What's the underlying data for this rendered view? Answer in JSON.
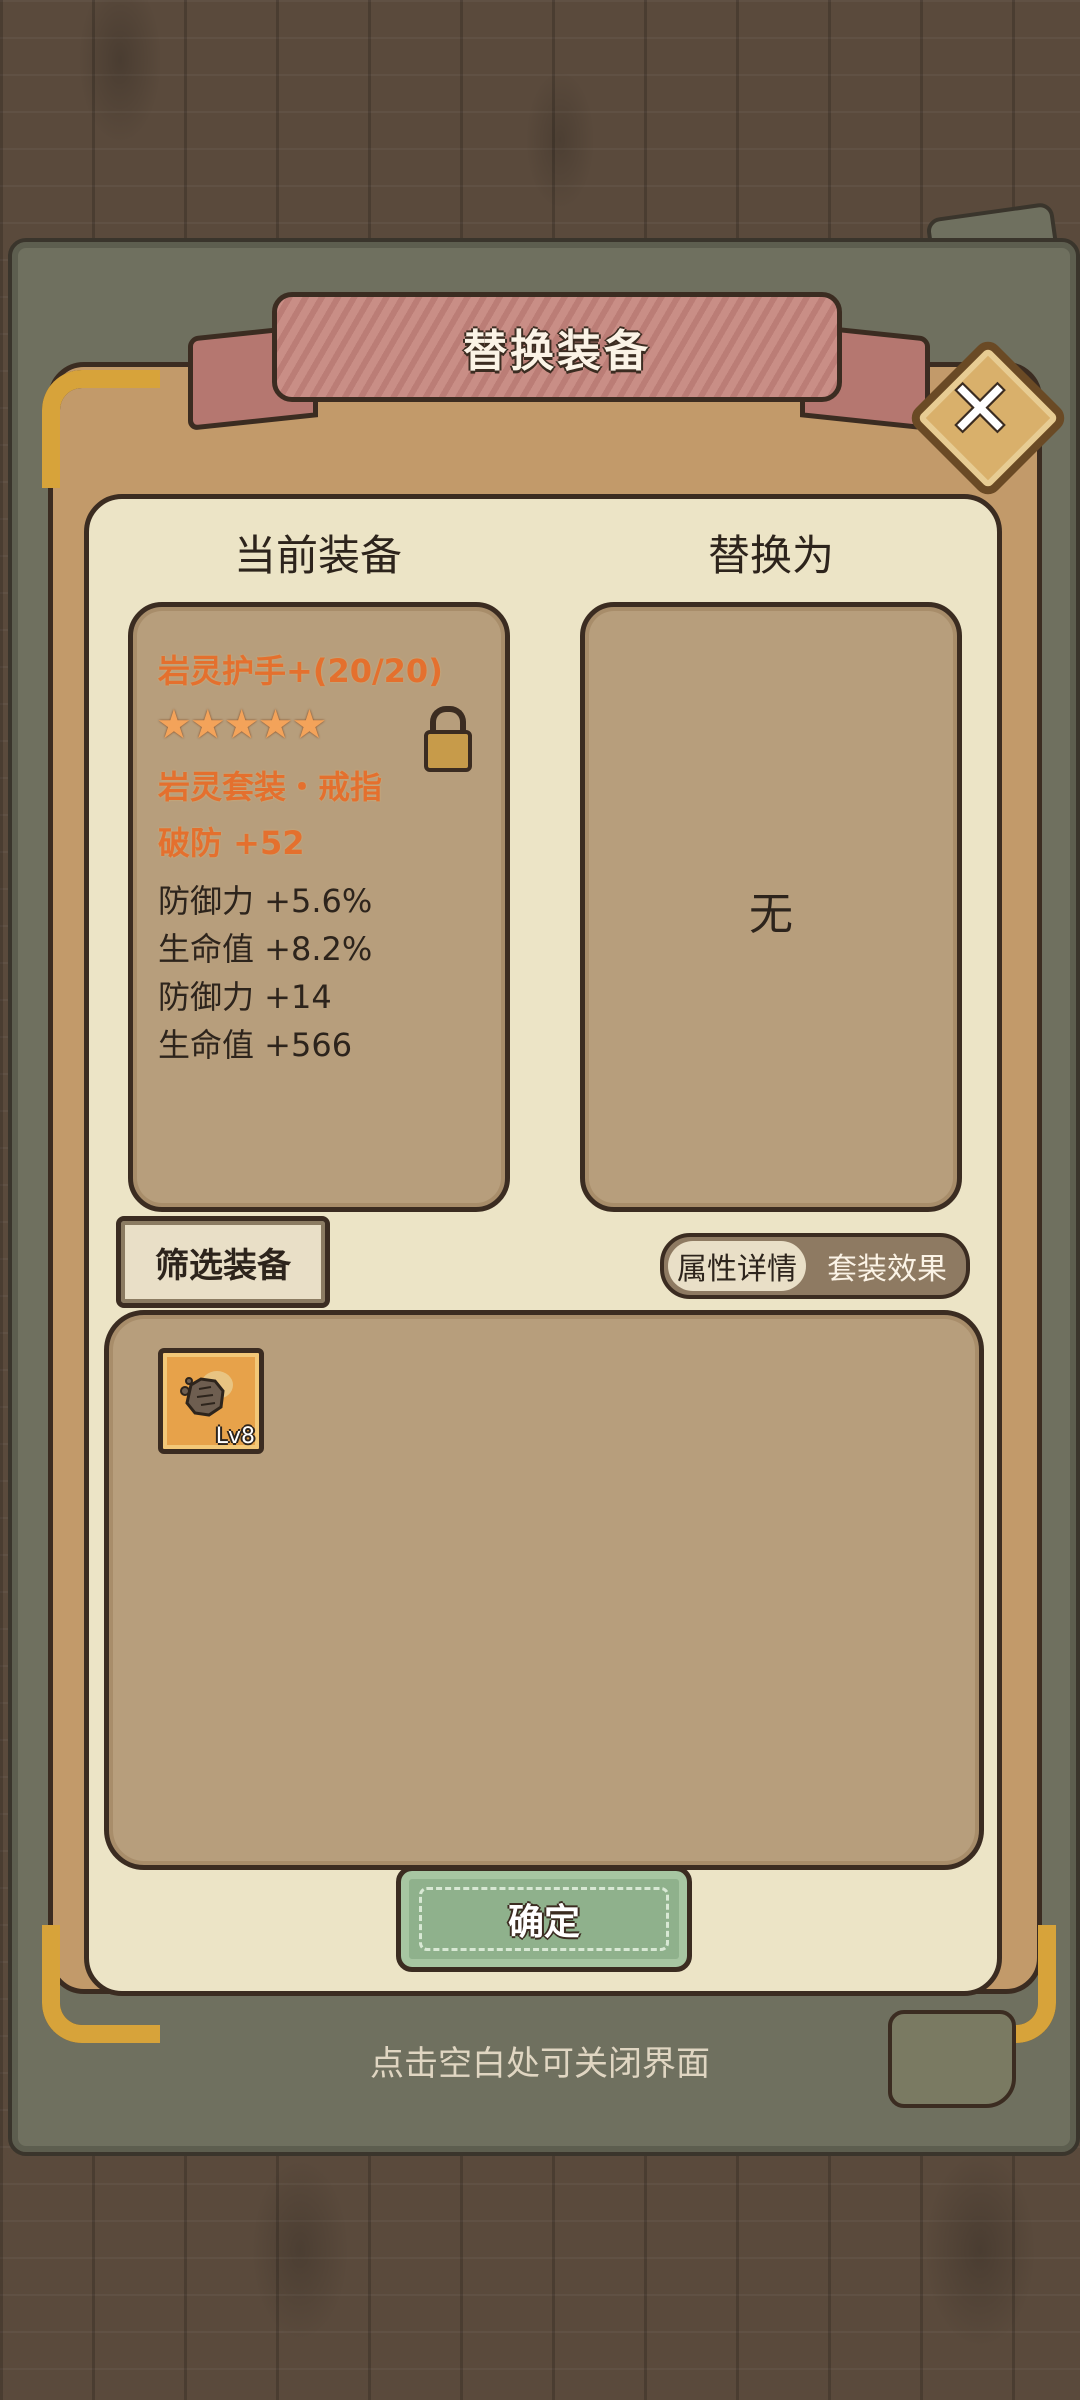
{
  "dialog": {
    "title": "替换装备",
    "close_icon": "close-icon"
  },
  "current": {
    "heading": "当前装备",
    "name": "岩灵护手+(20/20)",
    "stars": "★★★★★",
    "star_rating": 5,
    "set_label": "岩灵套装・戒指",
    "main_stat": "破防 +52",
    "sub_stats": [
      "防御力 +5.6%",
      "生命值 +8.2%",
      "防御力 +14",
      "生命值 +566"
    ],
    "locked": true
  },
  "replace": {
    "heading": "替换为",
    "empty_text": "无"
  },
  "controls": {
    "filter_label": "筛选装备",
    "toggle_on": "属性详情",
    "toggle_off": "套装效果"
  },
  "inventory": {
    "items": [
      {
        "level": "Lv8",
        "icon": "gauntlet-icon"
      }
    ]
  },
  "confirm_label": "确定",
  "hint": "点击空白处可关闭界面",
  "colors": {
    "accent_orange": "#e4702e",
    "confirm_green": "#8fb18c",
    "ribbon_pink": "#c98e86"
  }
}
